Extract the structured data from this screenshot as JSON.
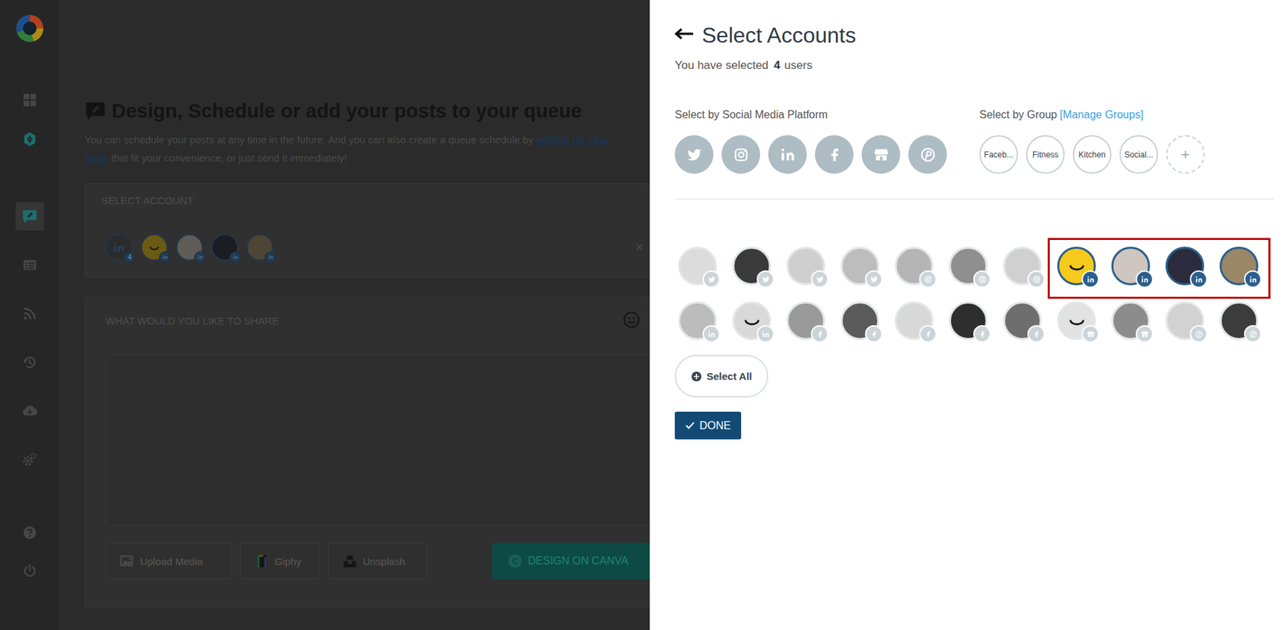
{
  "sidebar": {
    "items": [
      {
        "kind": "dashboard",
        "selected": false
      },
      {
        "kind": "billing",
        "selected": false
      },
      {
        "kind": "compose",
        "selected": true
      },
      {
        "kind": "queue",
        "selected": false
      },
      {
        "kind": "feeds",
        "selected": false
      },
      {
        "kind": "history",
        "selected": false
      },
      {
        "kind": "import",
        "selected": false
      },
      {
        "kind": "settings",
        "selected": false
      }
    ],
    "bottom_items": [
      {
        "kind": "help",
        "selected": false
      },
      {
        "kind": "logout",
        "selected": false
      }
    ]
  },
  "composer": {
    "title": "Design, Schedule or add your posts to your queue",
    "subtitle": {
      "before": "You can schedule your posts at any time in the future. And you can also create a queue schedule by ",
      "link_start": "setting up your",
      "link_end": "slots",
      "after": " that fit your convenience, or just send it immediately!"
    },
    "select_account": {
      "label": "SELECT ACCOUNT",
      "count": "4",
      "close": "×",
      "avatars": [
        {
          "kind": "linkedin"
        },
        {
          "kind": "linkedin"
        },
        {
          "kind": "linkedin"
        },
        {
          "kind": "linkedin"
        }
      ]
    },
    "share": {
      "label": "WHAT WOULD YOU LIKE TO SHARE",
      "buttons": [
        {
          "label": "Upload Media",
          "kind": "upload"
        },
        {
          "label": "Giphy",
          "kind": "giphy"
        },
        {
          "label": "Unsplash",
          "kind": "unsplash"
        },
        {
          "label": "DESIGN ON CANVA",
          "kind": "canva"
        }
      ]
    }
  },
  "drawer": {
    "title": "Select Accounts",
    "summary": {
      "before": "You have selected",
      "count": "4",
      "after": "users"
    },
    "platforms_label": "Select by Social Media Platform",
    "platforms": [
      {
        "kind": "twitter"
      },
      {
        "kind": "instagram"
      },
      {
        "kind": "linkedin"
      },
      {
        "kind": "facebook"
      },
      {
        "kind": "gmb"
      },
      {
        "kind": "pinterest"
      }
    ],
    "groups_label": "Select by Group",
    "manage_groups": "[Manage Groups]",
    "groups": [
      {
        "label": "Faceb..."
      },
      {
        "label": "Fitness"
      },
      {
        "label": "Kitchen"
      },
      {
        "label": "Social..."
      }
    ],
    "add_group": "+",
    "accounts": [
      {
        "kind": "twitter",
        "selected": false
      },
      {
        "kind": "twitter",
        "selected": false
      },
      {
        "kind": "twitter",
        "selected": false
      },
      {
        "kind": "twitter",
        "selected": false
      },
      {
        "kind": "instagram",
        "selected": false
      },
      {
        "kind": "instagram",
        "selected": false
      },
      {
        "kind": "instagram",
        "selected": false
      },
      {
        "kind": "linkedin",
        "selected": true
      },
      {
        "kind": "linkedin",
        "selected": true
      },
      {
        "kind": "linkedin",
        "selected": true
      },
      {
        "kind": "linkedin",
        "selected": true
      },
      {
        "kind": "linkedin",
        "selected": false
      },
      {
        "kind": "linkedin",
        "selected": false
      },
      {
        "kind": "facebook",
        "selected": false
      },
      {
        "kind": "facebook",
        "selected": false
      },
      {
        "kind": "facebook",
        "selected": false
      },
      {
        "kind": "facebook",
        "selected": false
      },
      {
        "kind": "facebook",
        "selected": false
      },
      {
        "kind": "gmb",
        "selected": false
      },
      {
        "kind": "gmb",
        "selected": false
      },
      {
        "kind": "pinterest",
        "selected": false
      },
      {
        "kind": "pinterest",
        "selected": false
      }
    ],
    "select_all": "Select All",
    "done": "DONE"
  }
}
